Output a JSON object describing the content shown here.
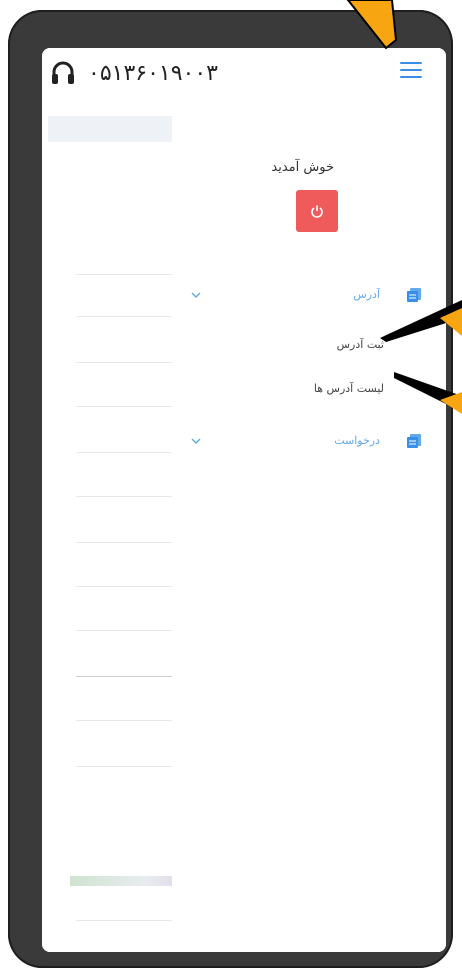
{
  "header": {
    "phone_number": "۰۵۱۳۶۰۱۹۰۰۳",
    "headset_icon": "headset-icon",
    "menu_icon": "hamburger-menu-icon"
  },
  "drawer": {
    "welcome_text": "خوش آمدید",
    "logout_icon": "power-icon",
    "menu": [
      {
        "label": "آدرس",
        "icon": "document-icon",
        "expanded": true,
        "children": [
          {
            "label": "ثبت آدرس"
          },
          {
            "label": "لیست آدرس ها"
          }
        ]
      },
      {
        "label": "درخواست",
        "icon": "document-icon",
        "expanded": false
      }
    ]
  },
  "colors": {
    "accent": "#3a8ee6",
    "link": "#62a9ea",
    "logout": "#ef5b5b",
    "annotation_arrow": "#f7a511"
  }
}
